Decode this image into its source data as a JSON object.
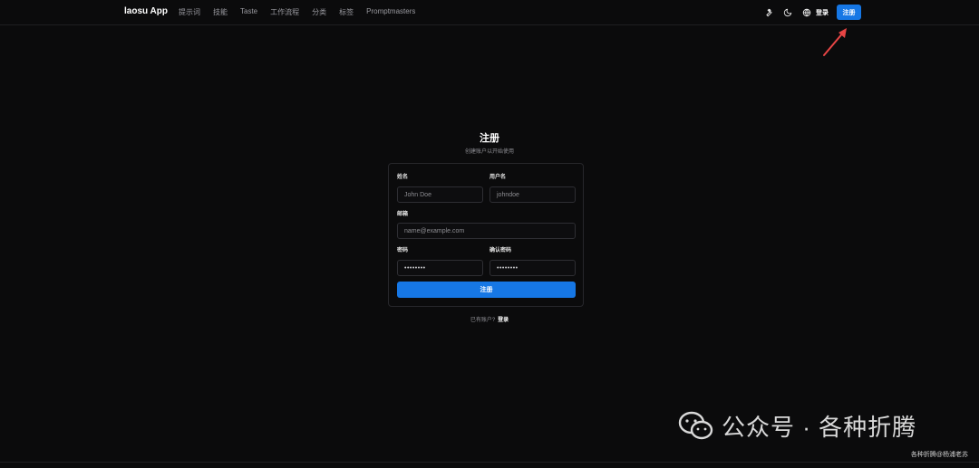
{
  "header": {
    "brand": "laosu App",
    "nav": [
      "提示词",
      "技能",
      "Taste",
      "工作流程",
      "分类",
      "标签",
      "Promptmasters"
    ],
    "icons": [
      "wrench-icon",
      "moon-icon",
      "globe-icon"
    ],
    "login_label": "登录",
    "signup_label": "注册"
  },
  "form": {
    "title": "注册",
    "subtitle": "创建账户以开始使用",
    "name_label": "姓名",
    "name_placeholder": "John Doe",
    "username_label": "用户名",
    "username_placeholder": "johndoe",
    "email_label": "邮箱",
    "email_placeholder": "name@example.com",
    "password_label": "密码",
    "password_value": "••••••••",
    "confirm_label": "确认密码",
    "confirm_value": "••••••••",
    "submit_label": "注册",
    "have_account": "已有账户?",
    "login_link": "登录"
  },
  "watermark": {
    "text": "公众号 · 各种折腾",
    "sub": "各种折腾@杨浦老苏"
  },
  "colors": {
    "accent": "#1677e5",
    "background": "#0b0b0c",
    "arrow": "#e84545"
  }
}
